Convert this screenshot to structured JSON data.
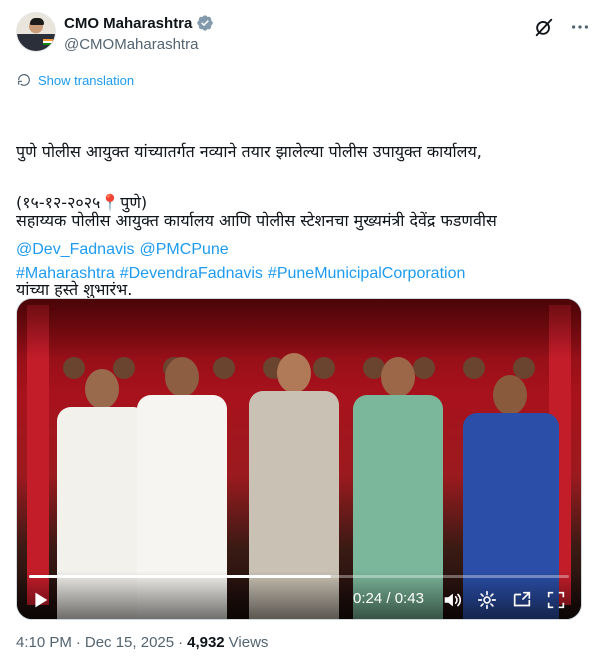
{
  "author": {
    "display_name": "CMO Maharashtra",
    "handle": "@CMOMaharashtra",
    "verified_icon": "verified-badge-icon"
  },
  "translate_label": "Show translation",
  "tweet": {
    "line1": "पुणे पोलीस आयुक्त यांच्यातर्गत नव्याने तयार झालेल्या पोलीस उपायुक्त कार्यालय,",
    "line2": "सहाय्यक पोलीस आयुक्त कार्यालय आणि पोलीस स्टेशनचा मुख्यमंत्री देवेंद्र फडणवीस",
    "line3": "यांच्या हस्ते शुभारंभ.",
    "date_open": "(१५-१२-२०२५",
    "pin": "📍",
    "date_close": "पुणे)"
  },
  "mentions": [
    "@Dev_Fadnavis",
    "@PMCPune"
  ],
  "hashtags": [
    "#Maharashtra",
    "#DevendraFadnavis",
    "#PuneMunicipalCorporation"
  ],
  "video": {
    "current_time": "0:24",
    "separator": " / ",
    "duration": "0:43",
    "progress": 0.56
  },
  "meta": {
    "time": "4:10 PM",
    "dot1": "·",
    "date": "Dec 15, 2025",
    "dot2": "·",
    "views_count": "4,932",
    "views_label": "Views"
  },
  "colors": {
    "accent": "#1d9bf0",
    "verified": "#829aab",
    "text": "#0f1419",
    "secondary": "#536471"
  }
}
